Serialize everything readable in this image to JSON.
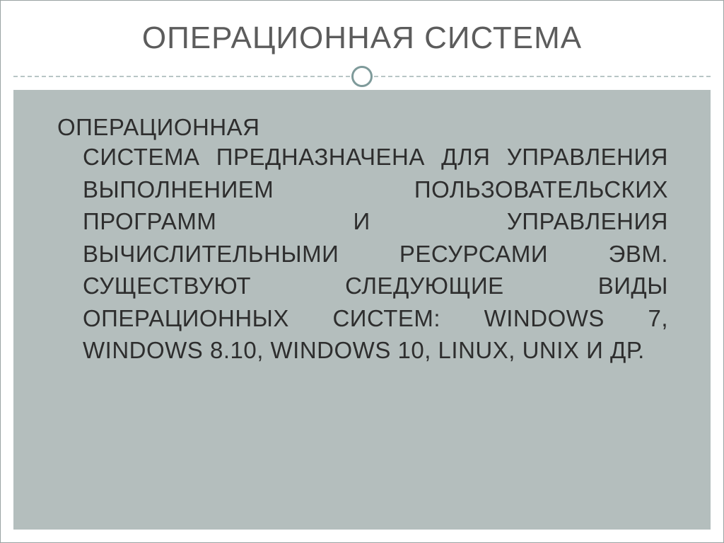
{
  "slide": {
    "title": "ОПЕРАЦИОННАЯ СИСТЕМА",
    "lead": "ОПЕРАЦИОННАЯ",
    "body": "СИСТЕМА ПРЕДНАЗНАЧЕНА ДЛЯ УПРАВЛЕНИЯ ВЫПОЛНЕНИЕМ ПОЛЬЗОВАТЕЛЬСКИХ ПРОГРАММ И УПРАВЛЕНИЯ ВЫЧИСЛИТЕЛЬНЫМИ РЕСУРСАМИ ЭВМ. СУЩЕСТВУЮТ СЛЕДУЮЩИЕ ВИДЫ ОПЕРАЦИОННЫХ СИСТЕМ: WINDOWS 7, WINDOWS 8.10, WINDOWS 10, LINUX, UNIX И ДР."
  }
}
